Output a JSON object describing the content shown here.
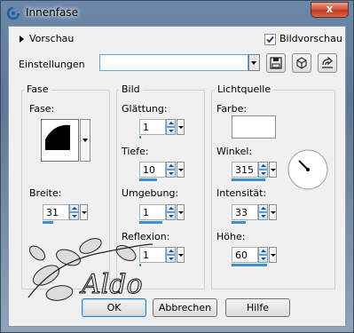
{
  "window": {
    "title": "Innenfase",
    "close_label": "x"
  },
  "top": {
    "preview_label": "Vorschau",
    "preview_checkbox_label": "Bildvorschau",
    "preview_checked": true,
    "settings_label": "Einstellungen",
    "settings_value": ""
  },
  "groups": {
    "fase": {
      "title": "Fase",
      "shape_label": "Fase:",
      "width_label": "Breite:",
      "width_value": "31"
    },
    "bild": {
      "title": "Bild",
      "smoothing_label": "Glättung:",
      "smoothing_value": "1",
      "depth_label": "Tiefe:",
      "depth_value": "10",
      "ambience_label": "Umgebung:",
      "ambience_value": "1",
      "reflection_label": "Reflexion:",
      "reflection_value": "1"
    },
    "light": {
      "title": "Lichtquelle",
      "color_label": "Farbe:",
      "color_value": "#ffffff",
      "angle_label": "Winkel:",
      "angle_value": "315",
      "intensity_label": "Intensität:",
      "intensity_value": "33",
      "elevation_label": "Höhe:",
      "elevation_value": "60"
    }
  },
  "buttons": {
    "ok": "OK",
    "cancel": "Abbrechen",
    "help": "Hilfe"
  },
  "watermark": {
    "text": "Aldo"
  }
}
